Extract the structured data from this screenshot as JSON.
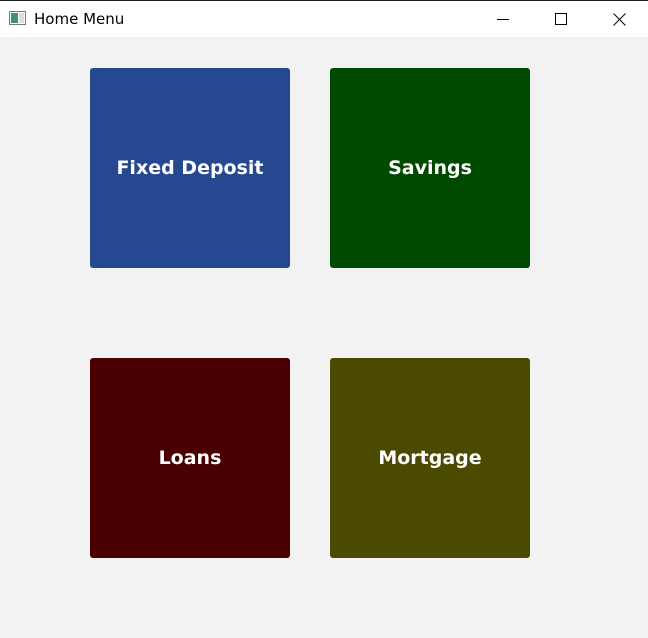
{
  "window": {
    "title": "Home Menu",
    "controls": {
      "minimize_icon": "minimize-icon",
      "maximize_icon": "maximize-icon",
      "close_icon": "close-icon"
    }
  },
  "menu": {
    "tiles": [
      {
        "label": "Fixed Deposit",
        "color": "#264891"
      },
      {
        "label": "Savings",
        "color": "#004a00"
      },
      {
        "label": "Loans",
        "color": "#4a0000"
      },
      {
        "label": "Mortgage",
        "color": "#4a4a00"
      }
    ]
  },
  "colors": {
    "background": "#f2f2f2",
    "titlebar": "#ffffff"
  }
}
